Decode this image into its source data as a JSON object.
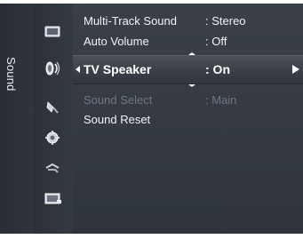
{
  "sidebar": {
    "tab_label": "Sound",
    "icons": [
      "picture-icon",
      "sound-icon",
      "channel-icon",
      "setup-icon",
      "input-icon",
      "application-icon"
    ],
    "active_icon": "sound-icon"
  },
  "menu": {
    "items": [
      {
        "label": "Multi-Track Sound",
        "value": ": Stereo",
        "state": "normal"
      },
      {
        "label": "Auto Volume",
        "value": ": Off",
        "state": "normal"
      },
      {
        "label": "TV Speaker",
        "value": ": On",
        "state": "selected"
      },
      {
        "label": "Sound Select",
        "value": ": Main",
        "state": "disabled"
      },
      {
        "label": "Sound Reset",
        "value": "",
        "state": "normal"
      }
    ]
  },
  "colors": {
    "panel_bg": "#363b43",
    "text": "#f2f3f5",
    "disabled_text": "#6f7783",
    "highlight": "#464b54"
  }
}
